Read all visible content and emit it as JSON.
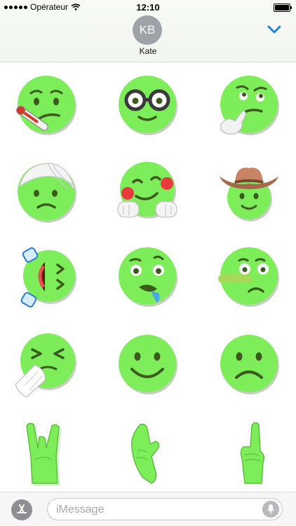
{
  "status": {
    "carrier": "Opérateur",
    "time": "12:10"
  },
  "header": {
    "initials": "KB",
    "contact_name": "Kate",
    "collapse_icon": "chevron-down-icon"
  },
  "colors": {
    "face": "#7dee5a",
    "feature": "#3b5a1c",
    "accent_blue": "#1a7ee6",
    "placeholder": "#a8a8ad"
  },
  "stickers": [
    {
      "name": "sick-thermometer-face"
    },
    {
      "name": "nerd-glasses-face"
    },
    {
      "name": "thinking-face"
    },
    {
      "name": "head-bandage-face"
    },
    {
      "name": "hugging-face"
    },
    {
      "name": "cowboy-hat-face"
    },
    {
      "name": "rolling-laughing-face"
    },
    {
      "name": "drooling-face"
    },
    {
      "name": "lying-face"
    },
    {
      "name": "sneezing-face"
    },
    {
      "name": "smiling-face"
    },
    {
      "name": "frowning-face"
    },
    {
      "name": "rock-on-hand"
    },
    {
      "name": "call-me-hand"
    },
    {
      "name": "pointing-up-hand"
    }
  ],
  "composer": {
    "placeholder": "iMessage",
    "left_icon": "app-store-icon",
    "right_icon": "microphone-icon"
  }
}
